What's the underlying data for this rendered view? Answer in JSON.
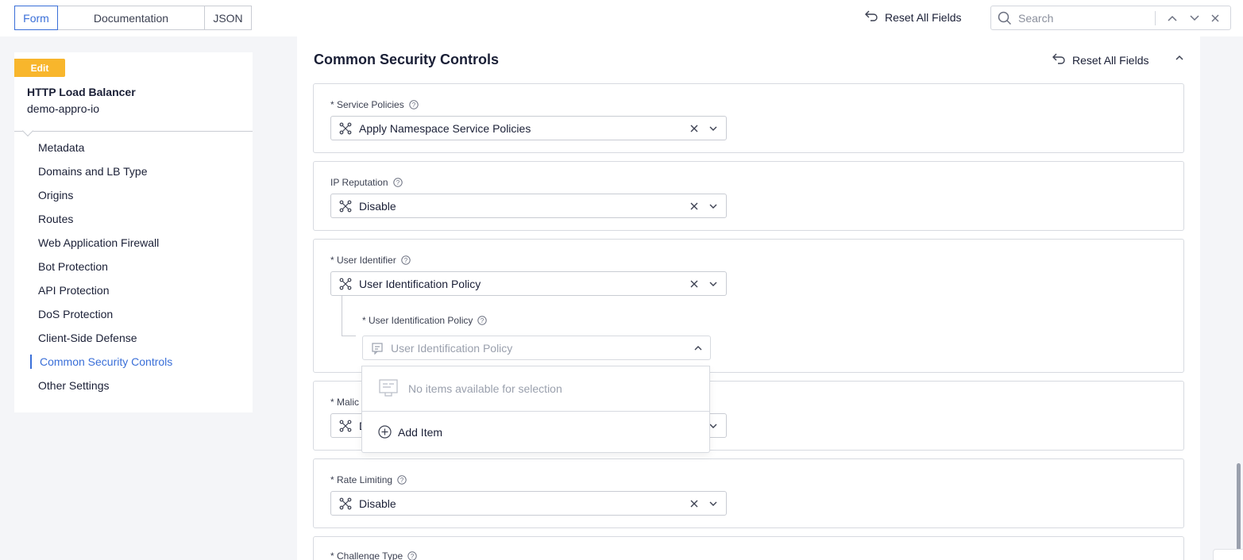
{
  "view_tabs": [
    "Form",
    "Documentation",
    "JSON"
  ],
  "topbar": {
    "reset_label": "Reset All Fields",
    "search_placeholder": "Search"
  },
  "sidebar": {
    "badge": "Edit",
    "object_type": "HTTP Load Balancer",
    "object_name": "demo-appro-io",
    "items": [
      {
        "label": "Metadata"
      },
      {
        "label": "Domains and LB Type"
      },
      {
        "label": "Origins"
      },
      {
        "label": "Routes"
      },
      {
        "label": "Web Application Firewall"
      },
      {
        "label": "Bot Protection"
      },
      {
        "label": "API Protection"
      },
      {
        "label": "DoS Protection"
      },
      {
        "label": "Client-Side Defense"
      },
      {
        "label": "Common Security Controls",
        "active": true
      },
      {
        "label": "Other Settings"
      }
    ]
  },
  "section": {
    "title": "Common Security Controls",
    "reset_label": "Reset All Fields"
  },
  "fields": {
    "service_policies": {
      "label": "* Service Policies",
      "value": "Apply Namespace Service Policies"
    },
    "ip_reputation": {
      "label": "IP Reputation",
      "value": "Disable"
    },
    "user_identifier": {
      "label": "* User Identifier",
      "value": "User Identification Policy"
    },
    "user_identification_policy": {
      "label": "* User Identification Policy",
      "placeholder": "User Identification Policy"
    },
    "malicious_user": {
      "label": "* Malic",
      "value": "D"
    },
    "rate_limiting": {
      "label": "* Rate Limiting",
      "value": "Disable"
    },
    "challenge_type": {
      "label": "* Challenge Type"
    }
  },
  "dropdown": {
    "empty_text": "No items available for selection",
    "add_label": "Add Item"
  },
  "colors": {
    "accent": "#3a6fd8",
    "badge": "#f8b62c",
    "background": "#f4f5f8"
  }
}
